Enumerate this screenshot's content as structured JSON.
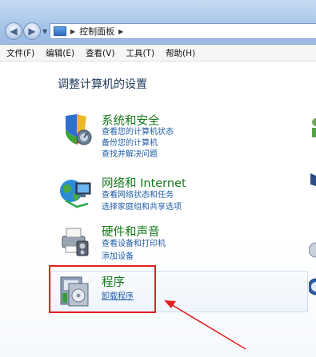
{
  "address_bar": {
    "breadcrumb": "控制面板",
    "icons": {
      "folder": "control-panel-icon"
    }
  },
  "menu": {
    "items": [
      "文件(F)",
      "编辑(E)",
      "查看(V)",
      "工具(T)",
      "帮助(H)"
    ]
  },
  "content": {
    "title": "调整计算机的设置",
    "categories": [
      {
        "title": "系统和安全",
        "icon": "shield-icon",
        "links": [
          "查看您的计算机状态",
          "备份您的计算机",
          "查找并解决问题"
        ]
      },
      {
        "title": "网络和 Internet",
        "icon": "network-globe-icon",
        "links": [
          "查看网络状态和任务",
          "选择家庭组和共享选项"
        ]
      },
      {
        "title": "硬件和声音",
        "icon": "printer-icon",
        "links": [
          "查看设备和打印机",
          "添加设备"
        ]
      },
      {
        "title": "程序",
        "icon": "programs-icon",
        "links": [
          "卸载程序"
        ]
      }
    ]
  },
  "colors": {
    "category_title": "#167a1a",
    "link": "#1f5da8",
    "annotation": "#e02222"
  }
}
